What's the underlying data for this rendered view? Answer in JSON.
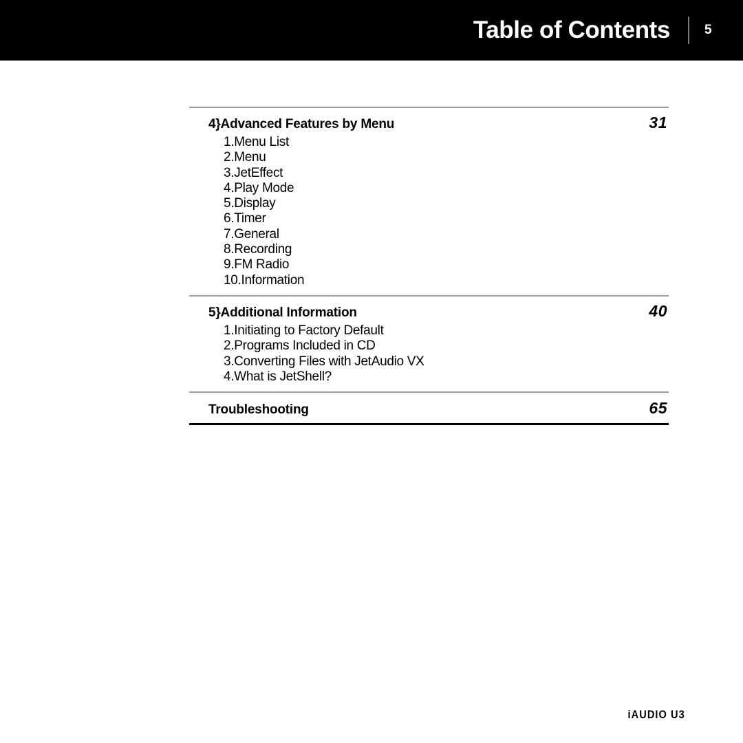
{
  "header": {
    "title": "Table of Contents",
    "page_number": "5"
  },
  "toc": {
    "sections": [
      {
        "title": "4}Advanced Features by Menu",
        "page": "31",
        "items": [
          "1.Menu List",
          "2.Menu",
          "3.JetEffect",
          "4.Play Mode",
          "5.Display",
          "6.Timer",
          "7.General",
          "8.Recording",
          "9.FM Radio",
          "10.Information"
        ]
      },
      {
        "title": "5}Additional Information",
        "page": "40",
        "items": [
          "1.Initiating to Factory Default",
          "2.Programs Included in CD",
          "3.Converting Files with JetAudio VX",
          "4.What is JetShell?"
        ]
      },
      {
        "title": "Troubleshooting",
        "page": "65",
        "items": []
      }
    ]
  },
  "footer": {
    "brand": "iAUDIO U3"
  },
  "colors": {
    "header_background": "#000000",
    "header_text": "#ffffff",
    "rule_thin": "#9a9a9a",
    "rule_thick": "#000000",
    "body_text": "#000000",
    "page_background": "#ffffff"
  }
}
